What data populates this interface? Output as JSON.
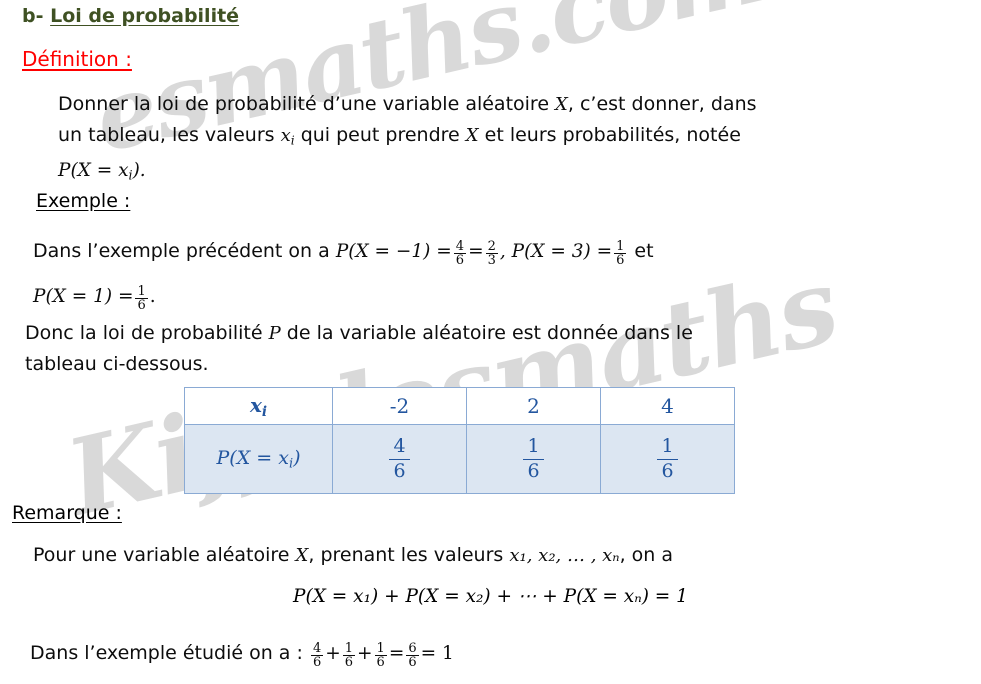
{
  "document": {
    "heading": {
      "prefix": "b- ",
      "title": "Loi de probabilité",
      "color": "#3f5123"
    },
    "sections": {
      "definition": {
        "label": "Définition :",
        "label_color": "#ff0000",
        "line1_a": "Donner la loi de probabilité d’une variable aléatoire ",
        "line1_var": "X",
        "line1_b": ", c’est donner, dans",
        "line2_a": "un tableau, les valeurs ",
        "line2_var": "x",
        "line2_var_sub": "i",
        "line2_b": " qui peut prendre ",
        "line2_var2": "X",
        "line2_c": " et leurs probabilités, notée",
        "line3_math": "P(X = x",
        "line3_sub": "i",
        "line3_end": ")."
      },
      "exemple": {
        "label": "Exemple :",
        "lead": "Dans l’exemple précédent on a ",
        "expr1": "P(X = −1) =",
        "frac1_num": "4",
        "frac1_den": "6",
        "eq_mid": "=",
        "frac2_num": "2",
        "frac2_den": "3",
        "expr2": ", P(X = 3) =",
        "frac3_num": "1",
        "frac3_den": "6",
        "et": " et",
        "line2_expr": "P(X = 1) =",
        "frac4_num": "1",
        "frac4_den": "6",
        "line2_end": "."
      },
      "donc": {
        "line1_a": "Donc la loi de probabilité ",
        "line1_var": "P",
        "line1_b": " de la variable aléatoire est donnée dans le",
        "line2": "tableau ci-dessous."
      },
      "remarque": {
        "label": "Remarque :",
        "line1_a": "Pour une variable aléatoire ",
        "line1_var": "X",
        "line1_b": ", prenant les valeurs ",
        "line1_vars": "x₁, x₂, … , xₙ",
        "line1_c": ", on a",
        "equation": "P(X = x₁) + P(X = x₂) + ⋯ + P(X = xₙ) = 1",
        "final_lead": "Dans l’exemple étudié on a : ",
        "f1_num": "4",
        "f1_den": "6",
        "plus1": "+",
        "f2_num": "1",
        "f2_den": "6",
        "plus2": "+",
        "f3_num": "1",
        "f3_den": "6",
        "eq1": "=",
        "f4_num": "6",
        "f4_den": "6",
        "eq2": "= 1"
      }
    },
    "table": {
      "header_label": "x",
      "header_label_sub": "i",
      "header_values": [
        "-2",
        "2",
        "4"
      ],
      "row_label": "P(X = x",
      "row_label_sub": "i",
      "row_label_end": ")",
      "row_values": [
        {
          "num": "4",
          "den": "6"
        },
        {
          "num": "1",
          "den": "6"
        },
        {
          "num": "1",
          "den": "6"
        }
      ],
      "header_bg": "#ffffff",
      "body_bg": "#dce6f2",
      "border_color": "#8aaad4",
      "text_color": "#23569f"
    },
    "watermark": {
      "text_top": "esmaths.com",
      "text_bottom": "Kiffelesmaths",
      "color": "#d9d9d9"
    }
  }
}
